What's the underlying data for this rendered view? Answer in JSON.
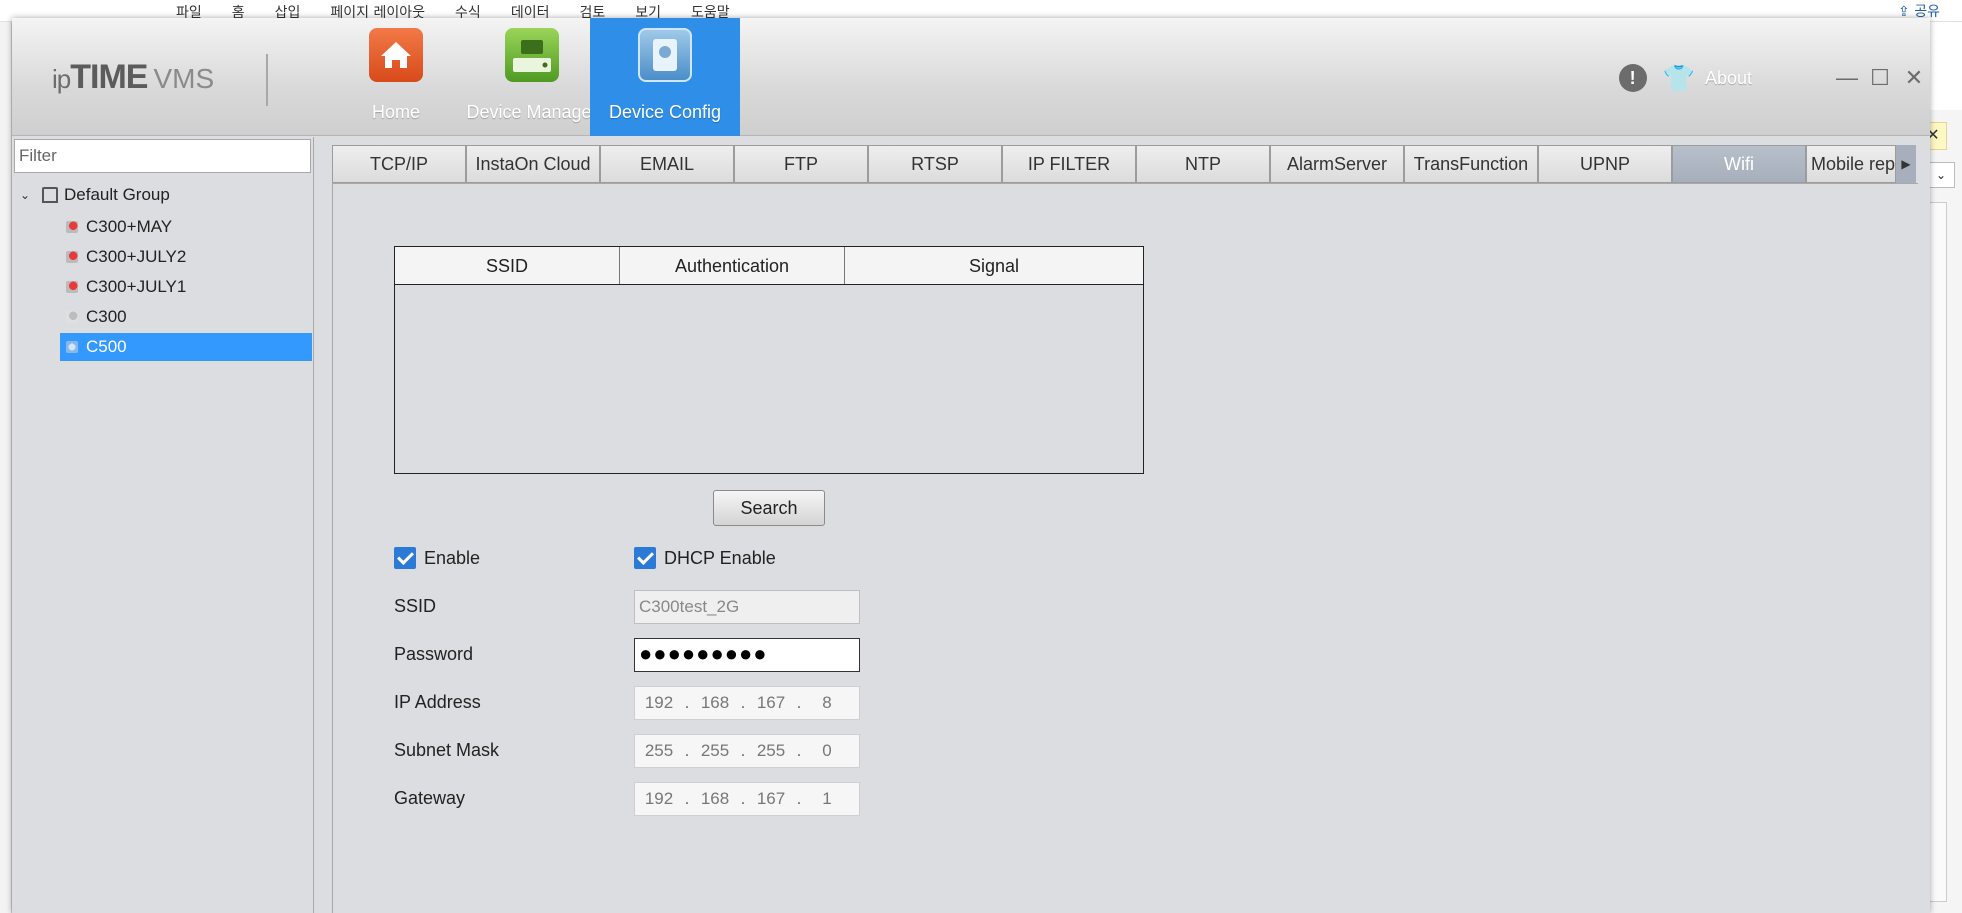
{
  "host_app": {
    "ribbon_menu": [
      "파일",
      "홈",
      "삽입",
      "페이지 레이아웃",
      "수식",
      "데이터",
      "검토",
      "보기",
      "도움말"
    ],
    "share": "공유"
  },
  "app": {
    "logo_ip": "ip",
    "logo_time": "TIME",
    "logo_vms": "VMS",
    "nav": {
      "home": "Home",
      "device_manager": "Device Manager",
      "device_config": "Device Config"
    },
    "about": "About",
    "accent_color": "#2f8fe8"
  },
  "sidebar": {
    "filter_placeholder": "Filter",
    "group": "Default Group",
    "devices": [
      {
        "name": "C300+MAY",
        "status": "red"
      },
      {
        "name": "C300+JULY2",
        "status": "red"
      },
      {
        "name": "C300+JULY1",
        "status": "red"
      },
      {
        "name": "C300",
        "status": "gray"
      },
      {
        "name": "C500",
        "status": "selected"
      }
    ]
  },
  "tabs": [
    "TCP/IP",
    "InstaOn Cloud",
    "EMAIL",
    "FTP",
    "RTSP",
    "IP FILTER",
    "NTP",
    "AlarmServer",
    "TransFunction",
    "UPNP",
    "Wifi",
    "Mobile report"
  ],
  "active_tab": "Wifi",
  "wifi": {
    "table_headers": [
      "SSID",
      "Authentication",
      "Signal"
    ],
    "search_label": "Search",
    "enable_label": "Enable",
    "dhcp_label": "DHCP Enable",
    "labels": {
      "ssid": "SSID",
      "password": "Password",
      "ip": "IP Address",
      "mask": "Subnet Mask",
      "gateway": "Gateway"
    },
    "ssid_value": "C300test_2G",
    "password_value": "●●●●●●●●●",
    "ip": [
      "192",
      "168",
      "167",
      "8"
    ],
    "mask": [
      "255",
      "255",
      "255",
      "0"
    ],
    "gateway": [
      "192",
      "168",
      "167",
      "1"
    ]
  }
}
